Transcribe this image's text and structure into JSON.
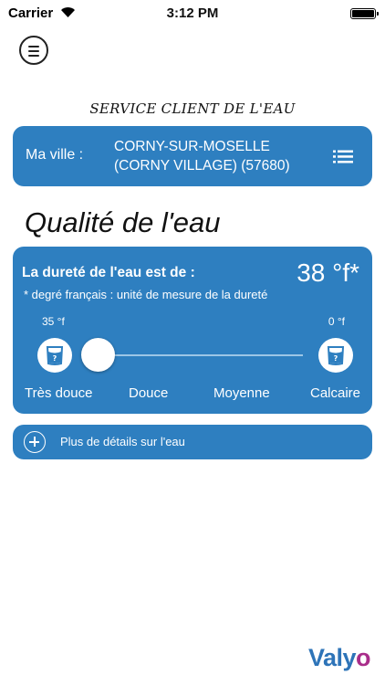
{
  "status_bar": {
    "carrier": "Carrier",
    "time": "3:12 PM",
    "wifi_icon": "wifi-icon",
    "battery_icon": "battery-icon"
  },
  "menu": {
    "icon": "hamburger-menu-icon"
  },
  "header": {
    "service_title": "SERVICE CLIENT DE L'EAU"
  },
  "city": {
    "label": "Ma ville :",
    "value": "CORNY-SUR-MOSELLE (CORNY VILLAGE) (57680)",
    "list_icon": "list-icon"
  },
  "quality": {
    "heading": "Qualité de l'eau"
  },
  "hardness": {
    "label": "La dureté de l'eau est de :",
    "value": "38 °f*",
    "note": "* degré français : unité de mesure de la dureté",
    "scale_min": "35 °f",
    "scale_max": "0 °f",
    "level_fraction": 0.0,
    "scale_labels": [
      "Très douce",
      "Douce",
      "Moyenne",
      "Calcaire"
    ]
  },
  "details": {
    "label": "Plus de détails sur l'eau",
    "icon": "plus-circle-icon"
  },
  "brand": {
    "logo_main": "Valy",
    "logo_accent": "o"
  },
  "colors": {
    "primary_blue": "#2e7fc0",
    "brand_blue": "#2e74b8",
    "brand_purple": "#a92d8a"
  }
}
